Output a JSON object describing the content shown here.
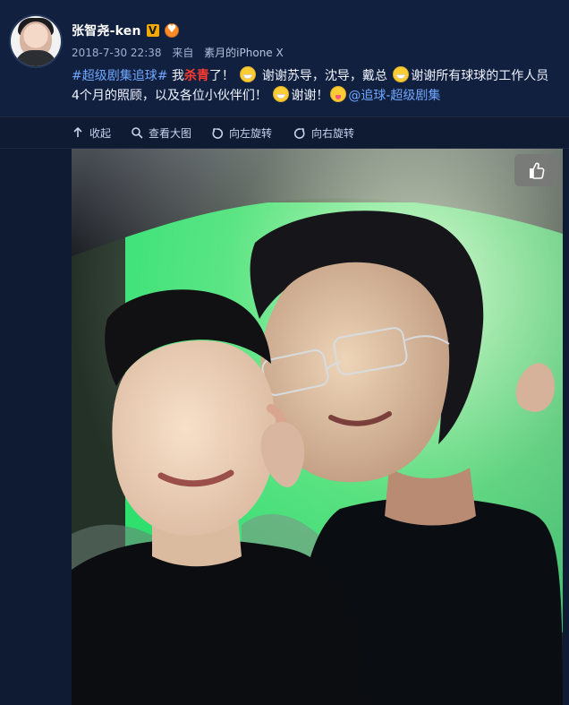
{
  "post": {
    "username": "张智尧-ken",
    "meta": {
      "time": "2018-7-30 22:38",
      "source_prefix": "来自",
      "source": "素月的iPhone X"
    },
    "text": {
      "hashtag": "#超级剧集追球#",
      "t1": " 我",
      "red": "杀青",
      "t2": "了！",
      "t3": " 谢谢苏导，沈导，戴总 ",
      "t4": "谢谢所有球球的工作人员4个月的照顾，以及各位小伙伴们！",
      "t5": "谢谢！",
      "mention": "@追球-超级剧集"
    },
    "icons": {
      "verified": "verified-badge-icon",
      "medal": "medal-icon",
      "emoji_1": "grinning-face-icon",
      "emoji_2": "grinning-face-icon",
      "emoji_3": "grinning-face-icon",
      "emoji_4": "tongue-face-icon"
    }
  },
  "toolbar": {
    "collapse": "收起",
    "view_large": "查看大图",
    "rotate_left": "向左旋转",
    "rotate_right": "向右旋转"
  },
  "photo": {
    "like_icon": "thumbs-up-icon"
  },
  "colors": {
    "bg": "#0f1a33",
    "header": "#12203f",
    "link": "#6fa7ff",
    "red": "#ff3b30",
    "muted": "#9fb0d1"
  }
}
